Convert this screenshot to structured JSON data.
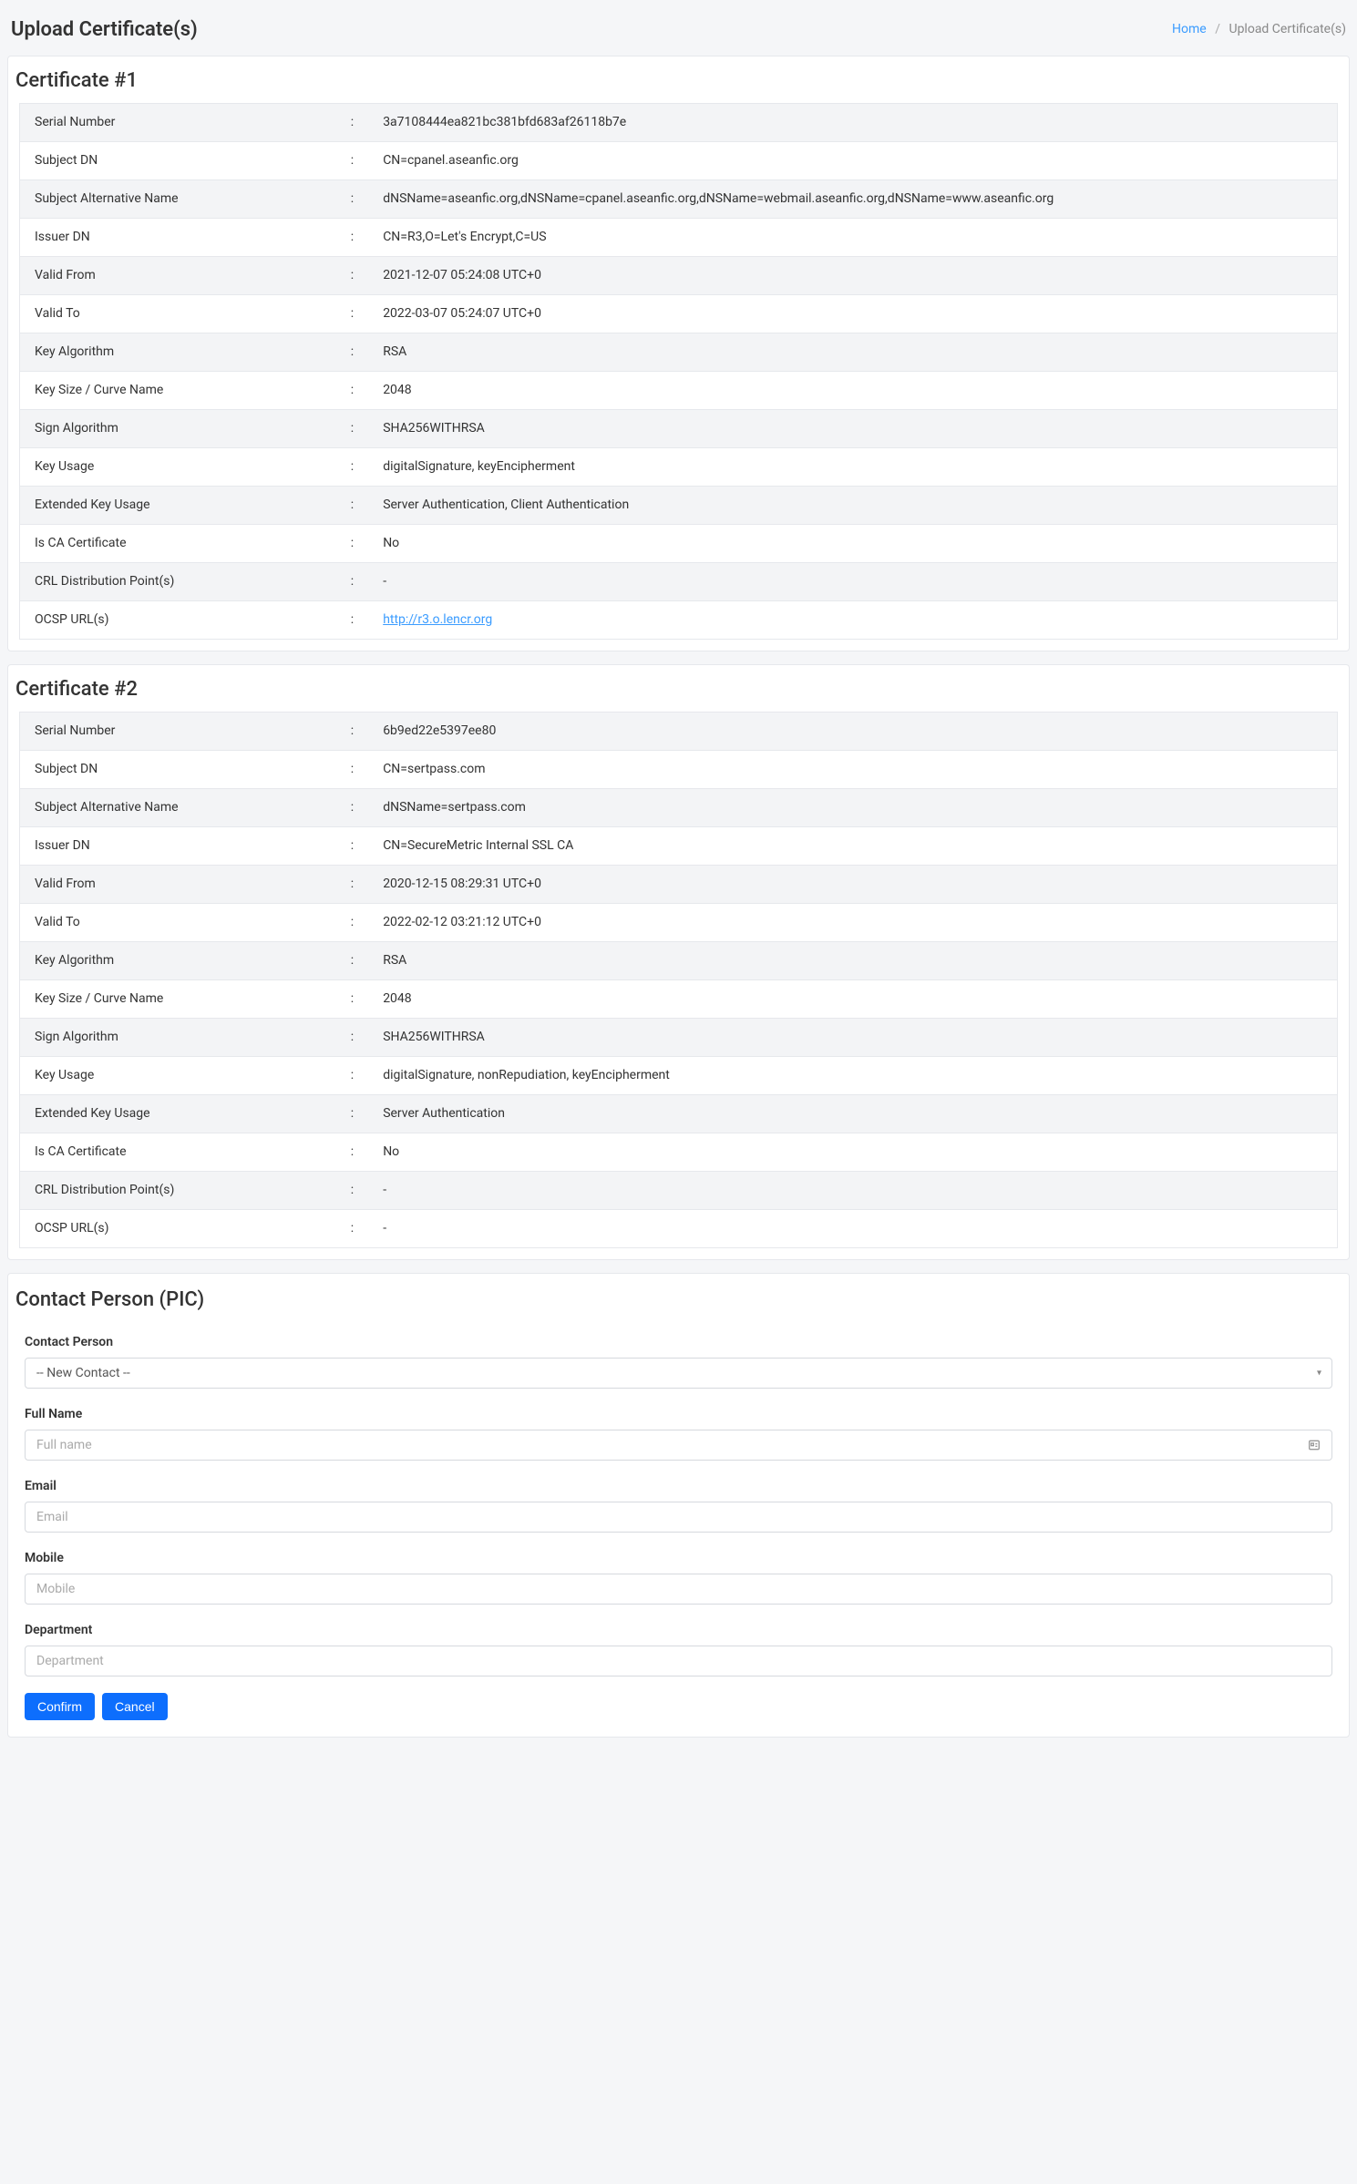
{
  "header": {
    "title": "Upload Certificate(s)",
    "breadcrumb": {
      "home": "Home",
      "current": "Upload Certificate(s)"
    }
  },
  "labels": {
    "serial": "Serial Number",
    "subject_dn": "Subject DN",
    "san": "Subject Alternative Name",
    "issuer_dn": "Issuer DN",
    "valid_from": "Valid From",
    "valid_to": "Valid To",
    "key_alg": "Key Algorithm",
    "key_size": "Key Size / Curve Name",
    "sign_alg": "Sign Algorithm",
    "key_usage": "Key Usage",
    "ext_key_usage": "Extended Key Usage",
    "is_ca": "Is CA Certificate",
    "crl": "CRL Distribution Point(s)",
    "ocsp": "OCSP URL(s)"
  },
  "cert1": {
    "title": "Certificate #1",
    "serial": "3a7108444ea821bc381bfd683af26118b7e",
    "subject_dn": "CN=cpanel.aseanfic.org",
    "san": "dNSName=aseanfic.org,dNSName=cpanel.aseanfic.org,dNSName=webmail.aseanfic.org,dNSName=www.aseanfic.org",
    "issuer_dn": "CN=R3,O=Let's Encrypt,C=US",
    "valid_from": "2021-12-07 05:24:08 UTC+0",
    "valid_to": "2022-03-07 05:24:07 UTC+0",
    "key_alg": "RSA",
    "key_size": "2048",
    "sign_alg": "SHA256WITHRSA",
    "key_usage": "digitalSignature, keyEncipherment",
    "ext_key_usage": "Server Authentication, Client Authentication",
    "is_ca": "No",
    "crl": "-",
    "ocsp_url": "http://r3.o.lencr.org"
  },
  "cert2": {
    "title": "Certificate #2",
    "serial": "6b9ed22e5397ee80",
    "subject_dn": "CN=sertpass.com",
    "san": "dNSName=sertpass.com",
    "issuer_dn": "CN=SecureMetric Internal SSL CA",
    "valid_from": "2020-12-15 08:29:31 UTC+0",
    "valid_to": "2022-02-12 03:21:12 UTC+0",
    "key_alg": "RSA",
    "key_size": "2048",
    "sign_alg": "SHA256WITHRSA",
    "key_usage": "digitalSignature, nonRepudiation, keyEncipherment",
    "ext_key_usage": "Server Authentication",
    "is_ca": "No",
    "crl": "-",
    "ocsp": "-"
  },
  "contact": {
    "title": "Contact Person (PIC)",
    "labels": {
      "contact_person": "Contact Person",
      "full_name": "Full Name",
      "email": "Email",
      "mobile": "Mobile",
      "department": "Department"
    },
    "select_value": "-- New Contact --",
    "placeholders": {
      "full_name": "Full name",
      "email": "Email",
      "mobile": "Mobile",
      "department": "Department"
    },
    "buttons": {
      "confirm": "Confirm",
      "cancel": "Cancel"
    }
  }
}
